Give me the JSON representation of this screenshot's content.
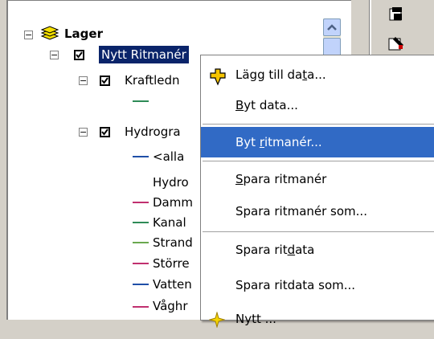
{
  "tree": {
    "root": {
      "label": "Lager",
      "icon": "layers-icon",
      "expander": "−"
    },
    "items": [
      {
        "label": "Nytt Ritmanér",
        "checked": true,
        "expander": "−",
        "selected": true
      },
      {
        "label": "Kraftledn",
        "checked": true,
        "expander": "−"
      },
      {
        "label": "Hydrogra",
        "checked": true,
        "expander": "−"
      },
      {
        "label": "<alla"
      },
      {
        "label": "Hydro"
      },
      {
        "label": "Damm"
      },
      {
        "label": "Kanal"
      },
      {
        "label": "Strand"
      },
      {
        "label": "Större"
      },
      {
        "label": "Vatten"
      },
      {
        "label": "Våghr"
      }
    ],
    "legend_colors": [
      "#2e8b57",
      "#1f4fa8",
      "#c0306f",
      "#2e8b57",
      "#6aa84f",
      "#c0306f",
      "#1f4fa8",
      "#c0306f"
    ]
  },
  "context_menu": {
    "items": [
      {
        "pre": "Lägg till da",
        "acc": "t",
        "post": "a..."
      },
      {
        "pre": "",
        "acc": "B",
        "post": "yt data..."
      },
      {
        "pre": "Byt ",
        "acc": "r",
        "post": "itmanér..."
      },
      {
        "pre": "",
        "acc": "S",
        "post": "para ritmanér"
      },
      {
        "pre": "Spara ritmanér som...",
        "acc": "",
        "post": ""
      },
      {
        "pre": "Spara rit",
        "acc": "d",
        "post": "ata"
      },
      {
        "pre": "Spara ritdata som...",
        "acc": "",
        "post": ""
      },
      {
        "pre": "Nytt ...",
        "acc": "",
        "post": ""
      }
    ],
    "highlighted_index": 2
  },
  "colors": {
    "selection": "#0a246a",
    "menu_highlight": "#316ac5"
  }
}
